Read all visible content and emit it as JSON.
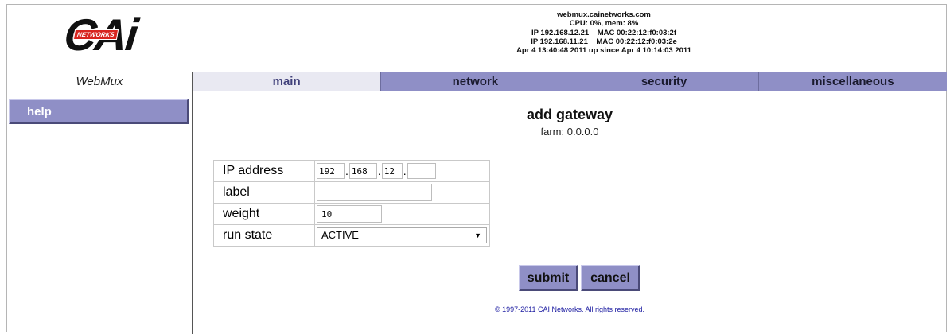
{
  "header": {
    "logo_text": "CAi",
    "logo_badge": "NETWORKS",
    "host": "webmux.cainetworks.com",
    "cpu_mem": "CPU: 0%, mem: 8%",
    "line_ip1": "IP 192.168.12.21    MAC 00:22:12:f0:03:2f",
    "line_ip2": "IP 192.168.11.21    MAC 00:22:12:f0:03:2e",
    "line_time": "Apr 4 13:40:48 2011 up since Apr 4 10:14:03 2011",
    "brand": "WebMux"
  },
  "tabs": [
    {
      "label": "main",
      "active": true
    },
    {
      "label": "network",
      "active": false
    },
    {
      "label": "security",
      "active": false
    },
    {
      "label": "miscellaneous",
      "active": false
    }
  ],
  "sidebar": {
    "help_label": "help"
  },
  "main": {
    "title": "add gateway",
    "subtitle": "farm: 0.0.0.0",
    "fields": {
      "ip_label": "IP address",
      "ip_octets": [
        "192",
        "168",
        "12",
        ""
      ],
      "label_label": "label",
      "label_value": "",
      "weight_label": "weight",
      "weight_value": "10",
      "runstate_label": "run state",
      "runstate_value": "ACTIVE"
    },
    "submit_label": "submit",
    "cancel_label": "cancel",
    "footer": "© 1997-2011 CAI Networks. All rights reserved."
  },
  "colors": {
    "tab_bg": "#8f8fc6",
    "tab_active_bg": "#e9e9f2",
    "footer": "#1a1aa0"
  }
}
